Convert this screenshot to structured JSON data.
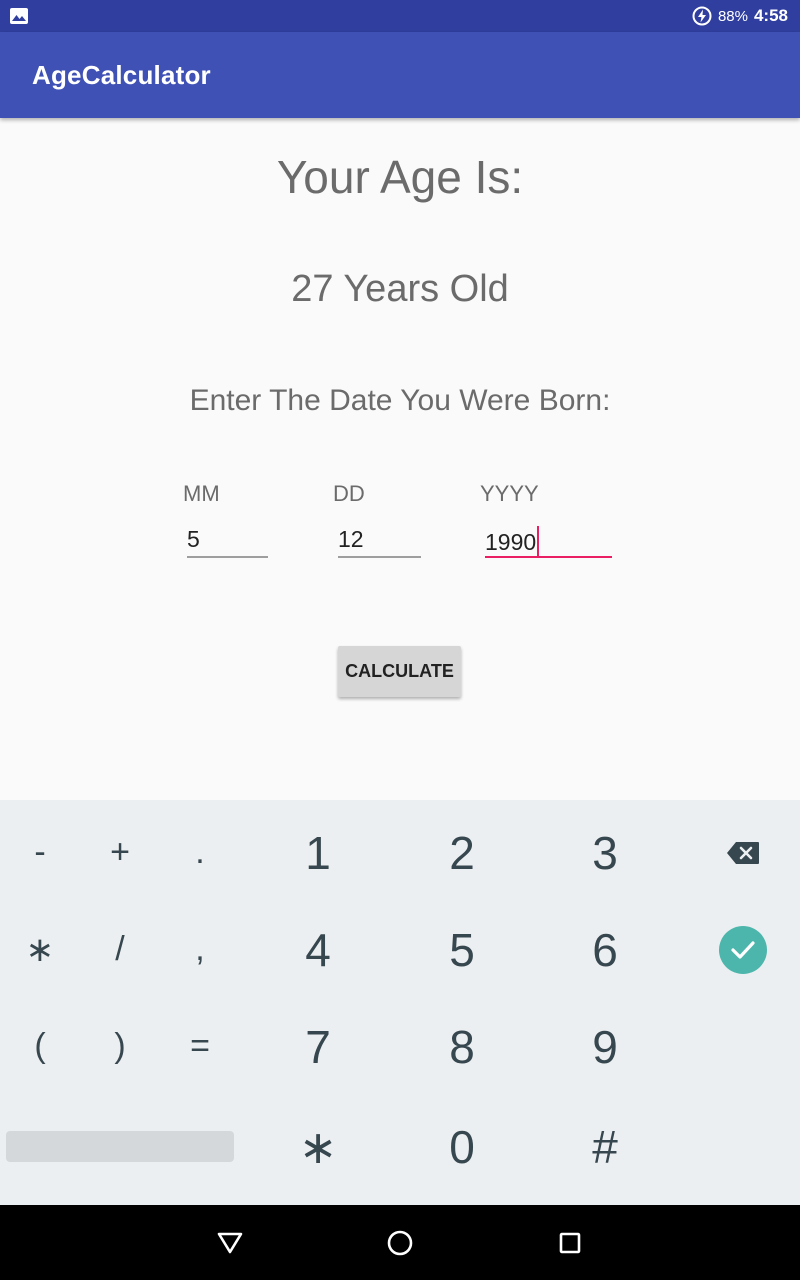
{
  "status_bar": {
    "battery": "88%",
    "time": "4:58",
    "icons": [
      "image-icon",
      "battery-charging-icon"
    ]
  },
  "app_bar": {
    "title": "AgeCalculator"
  },
  "content": {
    "heading": "Your Age Is:",
    "result": "27 Years Old",
    "prompt": "Enter The Date You Were Born:",
    "fields": [
      {
        "label": "MM",
        "value": "5"
      },
      {
        "label": "DD",
        "value": "12"
      },
      {
        "label": "YYYY",
        "value": "1990"
      }
    ],
    "button_label": "CALCULATE"
  },
  "keyboard": {
    "row1": [
      "-",
      "+",
      ".",
      "1",
      "2",
      "3"
    ],
    "row2": [
      "∗",
      "/",
      ",",
      "4",
      "5",
      "6"
    ],
    "row3": [
      "(",
      ")",
      "=",
      "7",
      "8",
      "9"
    ],
    "row4": [
      "∗",
      "0",
      "#"
    ],
    "icons": [
      "backspace-icon",
      "done-check-icon"
    ]
  },
  "colors": {
    "status_bar": "#303f9f",
    "app_bar": "#3f51b5",
    "accent": "#e91e63",
    "done_key": "#4db6ac",
    "keyboard_bg": "#eceff1"
  },
  "nav_bar": {
    "icons": [
      "back-icon",
      "home-icon",
      "recents-icon"
    ]
  }
}
